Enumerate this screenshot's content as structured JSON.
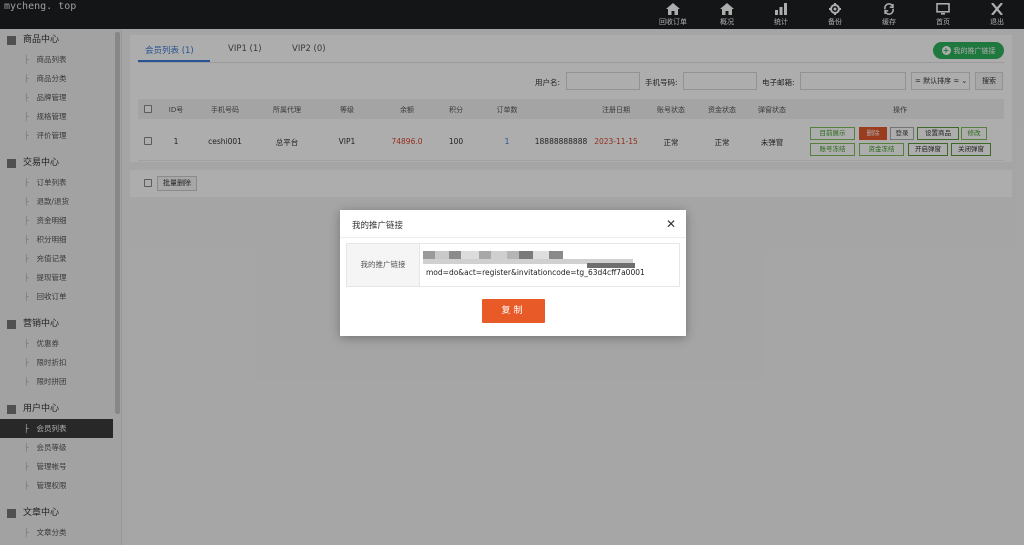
{
  "brand": "mycheng. top",
  "topnav": [
    {
      "label": "回收订单",
      "icon": "home-icon"
    },
    {
      "label": "概况",
      "icon": "home-icon"
    },
    {
      "label": "统计",
      "icon": "bar-chart-icon"
    },
    {
      "label": "备份",
      "icon": "gear-icon"
    },
    {
      "label": "缓存",
      "icon": "refresh-icon"
    },
    {
      "label": "首页",
      "icon": "monitor-icon"
    },
    {
      "label": "退出",
      "icon": "close-icon"
    }
  ],
  "sidebar": {
    "groups": [
      {
        "title": "商品中心",
        "icon": "box-icon",
        "items": [
          "商品列表",
          "商品分类",
          "品牌管理",
          "规格管理",
          "评价管理"
        ]
      },
      {
        "title": "交易中心",
        "icon": "bar-chart-icon",
        "items": [
          "订单列表",
          "退款/退货",
          "资金明细",
          "积分明细",
          "充值记录",
          "提现管理",
          "回收订单"
        ]
      },
      {
        "title": "营销中心",
        "icon": "grid-icon",
        "items": [
          "优惠券",
          "限时折扣",
          "限时拼团"
        ]
      },
      {
        "title": "用户中心",
        "icon": "user-icon",
        "items": [
          "会员列表",
          "会员等级",
          "管理帐号",
          "管理权限"
        ]
      },
      {
        "title": "文章中心",
        "icon": "document-icon",
        "items": [
          "文章分类"
        ]
      }
    ],
    "active_item": "会员列表"
  },
  "tabs": [
    {
      "label": "会员列表 (1)",
      "active": true
    },
    {
      "label": "VIP1 (1)",
      "active": false
    },
    {
      "label": "VIP2 (0)",
      "active": false
    }
  ],
  "promo_button": "我的推广链接",
  "filters": {
    "username_label": "用户名:",
    "phone_label": "手机号码:",
    "email_label": "电子邮箱:",
    "sort_value": "= 默认排序 =",
    "search_label": "搜索"
  },
  "table": {
    "headers": [
      "ID号",
      "手机号码",
      "所属代理",
      "等级",
      "余额",
      "积分",
      "订单数",
      "注册日期",
      "账号状态",
      "资金状态",
      "弹窗状态",
      "操作"
    ],
    "row": {
      "id": "1",
      "phone": "ceshi001",
      "agent": "总平台",
      "level": "VIP1",
      "balance": "74896.0",
      "points": "100",
      "orders": "1",
      "mobile": "18888888888",
      "reg_date": "2023-11-15",
      "account_status": "正常",
      "fund_status": "正常",
      "popup_status": "未弹窗"
    },
    "ops": [
      "目前展示",
      "删除",
      "登录",
      "设置商品",
      "修改",
      "账号冻结",
      "资金冻结",
      "开启弹窗",
      "关闭弹窗"
    ]
  },
  "bulk_delete": "批量删除",
  "modal": {
    "title": "我的推广链接",
    "link_label": "我的推广链接",
    "link_url": "mod=do&act=register&invitationcode=tg_63d4cff7a0001",
    "copy_label": "复制"
  }
}
